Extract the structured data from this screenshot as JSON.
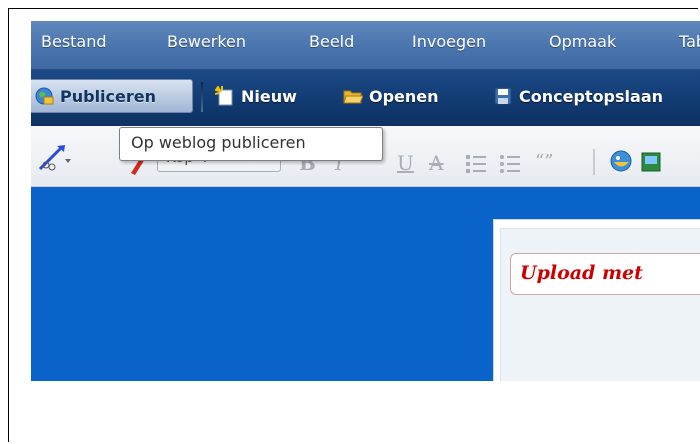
{
  "menu": {
    "items": [
      "Bestand",
      "Bewerken",
      "Beeld",
      "Invoegen",
      "Opmaak",
      "Tab"
    ]
  },
  "toolbar": {
    "publish_label": "Publiceren",
    "new_label": "Nieuw",
    "open_label": "Openen",
    "save_draft_label": "Conceptopslaan"
  },
  "tooltip": {
    "text": "Op weblog publiceren"
  },
  "format": {
    "style_value": "Kop 4",
    "bold": "B",
    "italic": "I",
    "underline": "U",
    "strike": "A",
    "quote": "“”"
  },
  "editor": {
    "heading_text": "Upload met"
  },
  "colors": {
    "menu_bg": "#4a74ad",
    "toolbar_bg": "#123c74",
    "editor_bg": "#0a63c8",
    "heading_red": "#cc0000"
  }
}
